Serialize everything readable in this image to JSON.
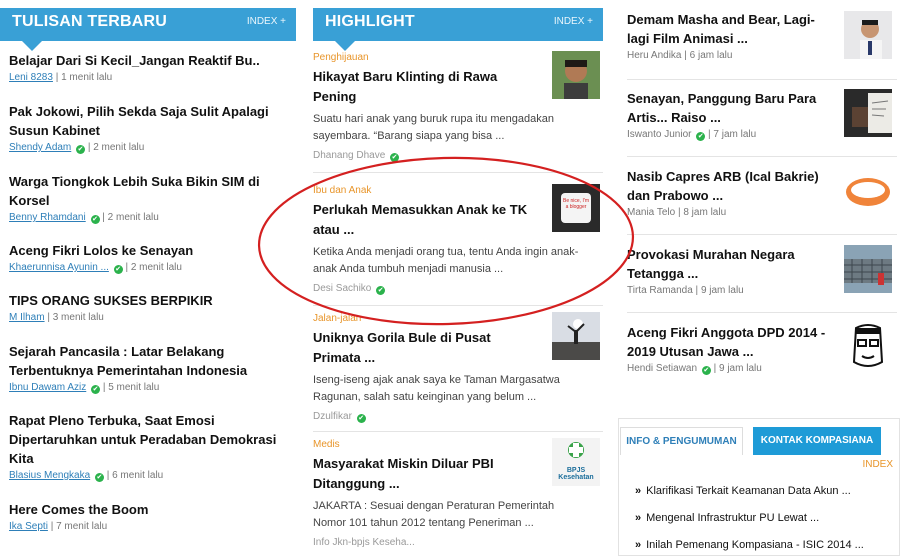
{
  "left": {
    "title": "TULISAN TERBARU",
    "index": "INDEX +",
    "items": [
      {
        "title": "Belajar Dari Si Kecil_Jangan Reaktif Bu..",
        "author": "Leni 8283",
        "verified": false,
        "time": "1 menit lalu"
      },
      {
        "title": "Pak Jokowi, Pilih Sekda Saja Sulit Apalagi Susun Kabinet",
        "author": "Shendy Adam",
        "verified": true,
        "time": "2 menit lalu"
      },
      {
        "title": "Warga Tiongkok Lebih Suka Bikin SIM di Korsel",
        "author": "Benny Rhamdani",
        "verified": true,
        "time": "2 menit lalu"
      },
      {
        "title": "Aceng Fikri Lolos ke Senayan",
        "author": "Khaerunnisa Ayunin ...",
        "verified": true,
        "time": "2 menit lalu"
      },
      {
        "title": "TIPS ORANG SUKSES BERPIKIR",
        "author": "M Ilham",
        "verified": false,
        "time": "3 menit lalu"
      },
      {
        "title": "Sejarah Pancasila : Latar Belakang Terbentuknya Pemerintahan Indonesia",
        "author": "Ibnu Dawam Aziz",
        "verified": true,
        "time": "5 menit lalu"
      },
      {
        "title": "Rapat Pleno Terbuka, Saat Emosi Dipertaruhkan untuk Peradaban Demokrasi Kita",
        "author": "Blasius Mengkaka",
        "verified": true,
        "time": "6 menit lalu"
      },
      {
        "title": "Here Comes the Boom",
        "author": "Ika Septi",
        "verified": false,
        "time": "7 menit lalu"
      }
    ]
  },
  "mid": {
    "title": "HIGHLIGHT",
    "index": "INDEX +",
    "items": [
      {
        "category": "Penghijauan",
        "title": "Hikayat Baru Klinting di Rawa Pening",
        "desc": "Suatu hari anak yang buruk rupa itu mengadakan sayembara. “Barang siapa yang bisa ...",
        "author": "Dhanang Dhave",
        "thumb": "person-photo"
      },
      {
        "category": "Ibu dan Anak",
        "title": "Perlukah Memasukkan Anak ke TK atau ...",
        "desc": "Ketika Anda menjadi orang tua, tentu Anda ingin anak-anak Anda tumbuh menjadi manusia ...",
        "author": "Desi Sachiko",
        "thumb": "mug-photo",
        "thumb_text": "Be nice, I'm a blogger"
      },
      {
        "category": "Jalan-jalan",
        "title": "Uniknya Gorila Bule di Pusat Primata ...",
        "desc": "Iseng-iseng ajak anak saya ke Taman Margasatwa Ragunan, salah satu keinginan yang belum ...",
        "author": "Dzulfikar",
        "thumb": "sunset-photo"
      },
      {
        "category": "Medis",
        "title": "Masyarakat Miskin Diluar PBI Ditanggung ...",
        "desc": "JAKARTA : Sesuai dengan Peraturan Pemerintah Nomor 101 tahun 2012 tentang Peneriman ...",
        "author": "Info Jkn-bpjs Keseha...",
        "thumb": "bpjs-logo",
        "thumb_text": "BPJS Kesehatan"
      }
    ]
  },
  "right": {
    "items": [
      {
        "title": "Demam Masha and Bear, Lagi-lagi Film Animasi ...",
        "author": "Heru Andika",
        "verified": false,
        "time": "6 jam lalu",
        "thumb": "man-photo"
      },
      {
        "title": "Senayan, Panggung Baru Para Artis... Raiso ...",
        "author": "Iswanto Junior",
        "verified": true,
        "time": "7 jam lalu",
        "thumb": "writing-photo"
      },
      {
        "title": "Nasib Capres ARB (Ical Bakrie) dan Prabowo ...",
        "author": "Mania Telo",
        "verified": false,
        "time": "8 jam lalu",
        "thumb": "wristband-photo"
      },
      {
        "title": "Provokasi Murahan Negara Tetangga ...",
        "author": "Tirta Ramanda",
        "verified": false,
        "time": "9 jam lalu",
        "thumb": "building-photo"
      },
      {
        "title": "Aceng Fikri Anggota DPD 2014 - 2019 Utusan Jawa ...",
        "author": "Hendi Setiawan",
        "verified": true,
        "time": "9 jam lalu",
        "thumb": "cartoon-face"
      }
    ],
    "tabs": [
      "INFO & PENGUMUMAN",
      "KONTAK KOMPASIANA"
    ],
    "tab_index": "INDEX",
    "announcements": [
      "Klarifikasi Terkait Keamanan Data Akun ...",
      "Mengenal Infrastruktur PU Lewat ...",
      "Inilah Pemenang Kompasiana - ISIC 2014 ..."
    ]
  },
  "colors": {
    "header_blue": "#39a0d6",
    "category_orange": "#e8952a",
    "link_blue": "#2e7fb8",
    "ring_red": "#d42020"
  }
}
